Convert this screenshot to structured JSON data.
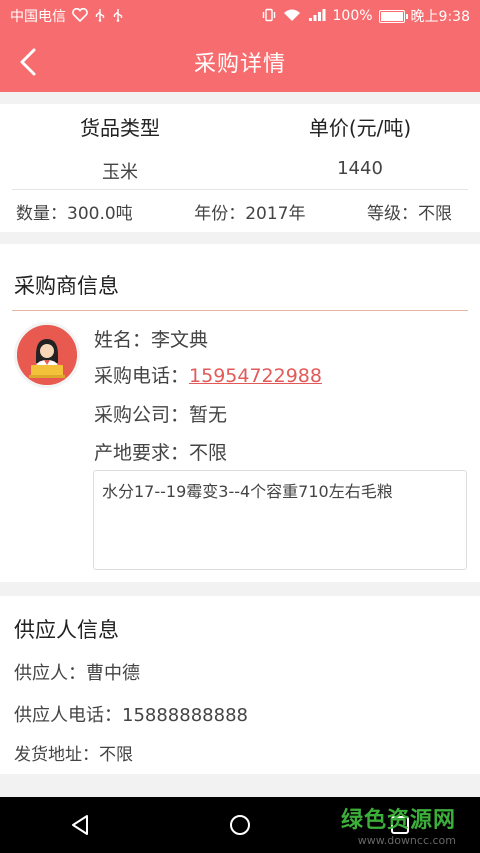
{
  "status_bar": {
    "carrier": "中国电信",
    "icons_left": [
      "heart-signal-icon",
      "usb-icon",
      "usb-icon"
    ],
    "battery_percent": "100%",
    "battery_level": 1.0,
    "time": "晚上9:38"
  },
  "header": {
    "title": "采购详情",
    "back_icon": "chevron-left-icon"
  },
  "goods": {
    "type_label": "货品类型",
    "price_label": "单价(元/吨)",
    "type_value": "玉米",
    "price_value": "1440",
    "quantity": "数量：300.0吨",
    "year": "年份：2017年",
    "grade": "等级：不限"
  },
  "buyer": {
    "section_title": "采购商信息",
    "name_label": "姓名：",
    "name": "李文典",
    "phone_label": "采购电话：",
    "phone": "15954722988",
    "company_label": "采购公司：",
    "company": "暂无",
    "origin_label": "产地要求：",
    "origin": "不限",
    "note": "水分17--19霉变3--4个容重710左右毛粮"
  },
  "supplier": {
    "section_title": "供应人信息",
    "name_label": "供应人：",
    "name": "曹中德",
    "phone_label": "供应人电话：",
    "phone": "15888888888",
    "address_label": "发货地址：",
    "address": "不限"
  },
  "watermark": {
    "main": "绿色资源网",
    "url": "www.downcc.com"
  },
  "colors": {
    "brand": "#f76d6f",
    "link": "#e25a5a",
    "watermark_green": "#3cae3a"
  }
}
